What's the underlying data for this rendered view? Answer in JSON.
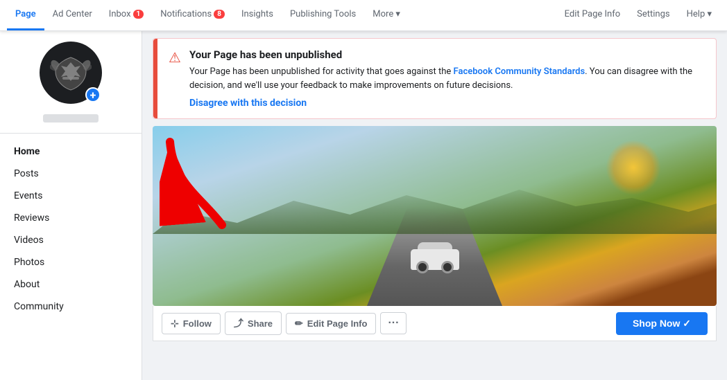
{
  "nav": {
    "tabs_left": [
      {
        "id": "page",
        "label": "Page",
        "active": true,
        "badge": null
      },
      {
        "id": "ad-center",
        "label": "Ad Center",
        "active": false,
        "badge": null
      },
      {
        "id": "inbox",
        "label": "Inbox",
        "active": false,
        "badge": "1"
      },
      {
        "id": "notifications",
        "label": "Notifications",
        "active": false,
        "badge": "8"
      },
      {
        "id": "insights",
        "label": "Insights",
        "active": false,
        "badge": null
      },
      {
        "id": "publishing-tools",
        "label": "Publishing Tools",
        "active": false,
        "badge": null
      },
      {
        "id": "more",
        "label": "More ▾",
        "active": false,
        "badge": null
      }
    ],
    "tabs_right": [
      {
        "id": "edit-page-info",
        "label": "Edit Page Info",
        "active": false,
        "badge": null
      },
      {
        "id": "settings",
        "label": "Settings",
        "active": false,
        "badge": null
      },
      {
        "id": "help",
        "label": "Help ▾",
        "active": false,
        "badge": null
      }
    ]
  },
  "sidebar": {
    "items": [
      {
        "id": "home",
        "label": "Home",
        "active": true
      },
      {
        "id": "posts",
        "label": "Posts",
        "active": false
      },
      {
        "id": "events",
        "label": "Events",
        "active": false
      },
      {
        "id": "reviews",
        "label": "Reviews",
        "active": false
      },
      {
        "id": "videos",
        "label": "Videos",
        "active": false
      },
      {
        "id": "photos",
        "label": "Photos",
        "active": false
      },
      {
        "id": "about",
        "label": "About",
        "active": false
      },
      {
        "id": "community",
        "label": "Community",
        "active": false
      }
    ]
  },
  "alert": {
    "title": "Your Page has been unpublished",
    "body_start": "Your Page has been unpublished for activity that goes against the ",
    "link_text": "Facebook Community Standards",
    "body_end": ". You can disagree with the decision, and we'll use your feedback to make improvements on future decisions.",
    "disagree_label": "Disagree with this decision"
  },
  "actions": {
    "follow_label": "Follow",
    "share_label": "Share",
    "edit_page_info_label": "Edit Page Info",
    "shop_now_label": "Shop Now ✓"
  }
}
